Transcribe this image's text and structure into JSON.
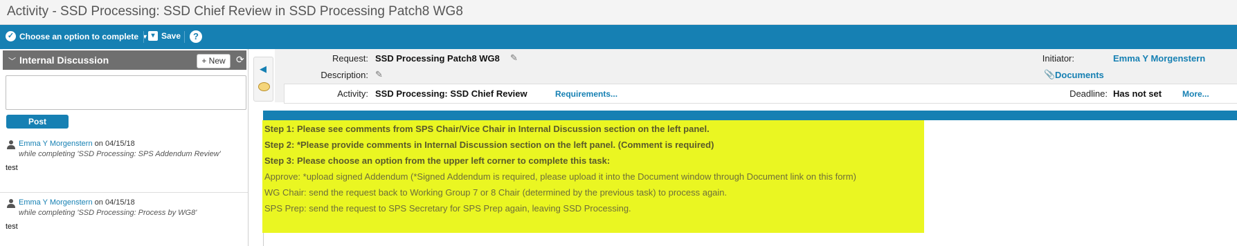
{
  "window": {
    "title": "Activity - SSD Processing: SSD Chief Review in SSD Processing Patch8 WG8"
  },
  "toolbar": {
    "choose_label": "Choose an option to complete",
    "save_label": "Save",
    "help_label": "?"
  },
  "discussion": {
    "title": "Internal Discussion",
    "new_label": "+ New",
    "post_label": "Post",
    "entries": [
      {
        "author": "Emma Y Morgenstern",
        "date": "on 04/15/18",
        "context": "while completing 'SSD Processing: SPS Addendum Review'",
        "text": "test"
      },
      {
        "author": "Emma Y Morgenstern",
        "date": "on 04/15/18",
        "context": "while completing 'SSD Processing: Process by WG8'",
        "text": "test"
      }
    ]
  },
  "details": {
    "request_label": "Request:",
    "request_value": "SSD Processing Patch8 WG8",
    "description_label": "Description:",
    "activity_label": "Activity:",
    "activity_value": "SSD Processing: SSD Chief Review",
    "requirements_link": "Requirements...",
    "initiator_label": "Initiator:",
    "initiator_value": "Emma Y Morgenstern",
    "documents_link": "Documents",
    "deadline_label": "Deadline:",
    "deadline_value": "Has not set",
    "more_link": "More..."
  },
  "instructions": [
    {
      "text": "Step 1: Please see comments from SPS Chair/Vice Chair in Internal Discussion section on the left panel.",
      "bold": true
    },
    {
      "text": "Step 2: *Please provide comments in Internal Discussion section on the left panel. (Comment is required)",
      "bold": true
    },
    {
      "text": "Step 3: Please choose an option from the upper left corner to complete this task:",
      "bold": true
    },
    {
      "text": "Approve: *upload signed Addendum (*Signed Addendum is required, please upload it into the Document window through Document link on this form)",
      "bold": false
    },
    {
      "text": "WG Chair: send the request back to Working Group 7 or 8 Chair (determined by the previous task) to process again.",
      "bold": false
    },
    {
      "text": "SPS Prep: send the request to SPS Secretary for SPS Prep again, leaving SSD Processing.",
      "bold": false
    }
  ],
  "colors": {
    "accent": "#1680b3",
    "highlight": "#eaf622"
  }
}
